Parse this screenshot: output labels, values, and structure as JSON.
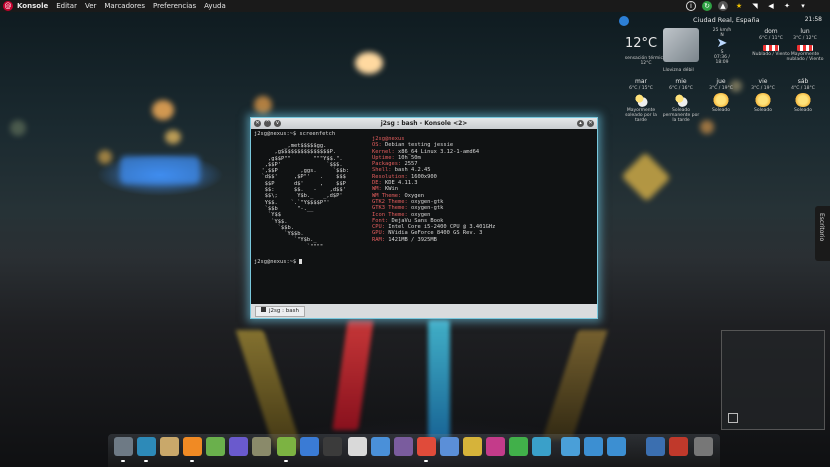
{
  "topbar": {
    "menu": [
      "Konsole",
      "Editar",
      "Ver",
      "Marcadores",
      "Preferencias",
      "Ayuda"
    ],
    "tray_icons": [
      "info-icon",
      "update-icon",
      "bell-icon",
      "star-icon",
      "wifi-icon",
      "volume-icon",
      "ubuntu-menu-icon",
      "arrow-icon"
    ]
  },
  "weather": {
    "clock": "21:58",
    "location": "Ciudad Real, España",
    "temperature": "12°C",
    "feels_like": "sensación térmica: 12°C",
    "condition": "Llovizna débil",
    "wind_speed": "25 km/h",
    "wind_from": "N",
    "wind_to": "S",
    "sunrise_sunset": "07:36 / 18:09",
    "forecast": [
      {
        "day": "dom",
        "range": "6°C / 11°C",
        "desc": "Nublado / Viento"
      },
      {
        "day": "lun",
        "range": "3°C / 12°C",
        "desc": "Mayormente nublado / Viento"
      },
      {
        "day": "mar",
        "range": "6°C / 15°C",
        "desc": "Mayormente soleado por la tarde"
      },
      {
        "day": "mie",
        "range": "6°C / 16°C",
        "desc": "Soleado permanente por la tarde"
      },
      {
        "day": "jue",
        "range": "3°C / 19°C",
        "desc": "Soleado"
      },
      {
        "day": "vie",
        "range": "3°C / 19°C",
        "desc": "Soleado"
      },
      {
        "day": "sáb",
        "range": "4°C / 18°C",
        "desc": "Soleado"
      }
    ]
  },
  "desktop_tab": "Escritorio",
  "konsole": {
    "title": "j2sg : bash - Konsole <2>",
    "prompt1": "j2sg@nexus:~$ screenfetch",
    "prompt2": "j2sg@nexus:~$",
    "tab_label": "j2sg : bash",
    "logo_lines": [
      "         _,met$$$$$gg.",
      "      ,g$$$$$$$$$$$$$$$P.",
      "    ,g$$P\"\"       \"\"\"Y$$.\".",
      "   ,$$P'              `$$$.",
      "  ',$$P       ,ggs.     `$$b:",
      "  `d$$'     ,$P\"'   .    $$$",
      "   $$P      d$'     ,    $$P",
      "   $$:      $$.   -    ,d$$'",
      "   $$\\;      Y$b._   _,d$P'",
      "   Y$$.    `.`\"Y$$$$P\"'",
      "   `$$b      \"-.__",
      "    `Y$$",
      "     `Y$$.",
      "       `$$b.",
      "         `Y$$b.",
      "            `\"Y$b._",
      "                `\"\"\"\""
    ],
    "user_host": "j2sg@nexus",
    "info": [
      {
        "k": "OS:",
        "v": "Debian testing jessie"
      },
      {
        "k": "Kernel:",
        "v": "x86_64 Linux 3.12-1-amd64"
      },
      {
        "k": "Uptime:",
        "v": "10h 50m"
      },
      {
        "k": "Packages:",
        "v": "2557"
      },
      {
        "k": "Shell:",
        "v": "bash 4.2.45"
      },
      {
        "k": "Resolution:",
        "v": "1600x900"
      },
      {
        "k": "DE:",
        "v": "KDE 4.11.3"
      },
      {
        "k": "WM:",
        "v": "KWin"
      },
      {
        "k": "WM Theme:",
        "v": "Oxygen"
      },
      {
        "k": "GTK2 Theme:",
        "v": "oxygen-gtk"
      },
      {
        "k": "GTK3 Theme:",
        "v": "oxygen-gtk"
      },
      {
        "k": "Icon Theme:",
        "v": "oxygen"
      },
      {
        "k": "Font:",
        "v": "DejaVu Sans Book"
      },
      {
        "k": "CPU:",
        "v": "Intel Core i5-2400 CPU @ 3.401GHz"
      },
      {
        "k": "GPU:",
        "v": "NVidia GeForce 8400 GS Rev. 3"
      },
      {
        "k": "RAM:",
        "v": "1421MB / 3925MB"
      }
    ]
  },
  "dock": {
    "icons": [
      {
        "name": "windows-icon",
        "color": "#6e7a85"
      },
      {
        "name": "terminal-icon",
        "color": "#2d8ab8"
      },
      {
        "name": "file-manager-icon",
        "color": "#c9a86a"
      },
      {
        "name": "webcam-icon",
        "color": "#f08a24"
      },
      {
        "name": "shopping-bag-icon",
        "color": "#6ab04c"
      },
      {
        "name": "pidgin-icon",
        "color": "#6a5acd"
      },
      {
        "name": "gimp-icon",
        "color": "#8a8a6a"
      },
      {
        "name": "android-icon",
        "color": "#7cb342"
      },
      {
        "name": "stats-icon",
        "color": "#3a7bd5"
      },
      {
        "name": "film-icon",
        "color": "#3b3b3b"
      },
      {
        "name": "eye-icon",
        "color": "#d9d9d9"
      },
      {
        "name": "browser-icon",
        "color": "#4a90d9"
      },
      {
        "name": "graphics-icon",
        "color": "#7a5c9e"
      },
      {
        "name": "media-icon",
        "color": "#e04b3a"
      },
      {
        "name": "document-icon",
        "color": "#5b8fd8"
      },
      {
        "name": "color-icon",
        "color": "#d6b33a"
      },
      {
        "name": "editor-icon",
        "color": "#c43b8a"
      },
      {
        "name": "qt-icon",
        "color": "#41b04a"
      },
      {
        "name": "monitor-icon",
        "color": "#3aa0c9"
      },
      {
        "name": "home-folder-icon",
        "color": "#4a9fd8"
      },
      {
        "name": "folder-icon",
        "color": "#3c8fd2"
      },
      {
        "name": "downloads-folder-icon",
        "color": "#3c8fd2"
      },
      {
        "name": "screenshot-icon",
        "color": "#3b6fb0"
      },
      {
        "name": "apps-grid-icon",
        "color": "#c0392b"
      },
      {
        "name": "power-icon",
        "color": "#777777"
      }
    ]
  }
}
